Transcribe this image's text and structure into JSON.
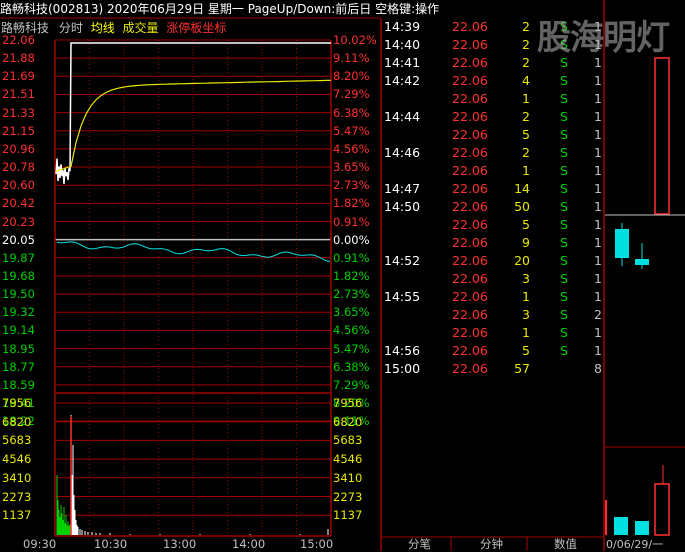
{
  "header": {
    "stock": "路畅科技(002813)",
    "date": "2020年06月29日 星期一",
    "hint": "PageUp/Down:前后日 空格键:操作",
    "sub_name": "路畅科技",
    "tab_timeshare": "分时",
    "tab_avg": "均线",
    "tab_volume": "成交量",
    "tab_limit": "涨停板坐标"
  },
  "price_axis": {
    "ref_price": 20.05,
    "up_prices": [
      "22.06",
      "21.88",
      "21.69",
      "21.51",
      "21.33",
      "21.15",
      "20.96",
      "20.78",
      "20.60",
      "20.42",
      "20.23"
    ],
    "up_pcts": [
      "10.02%",
      "9.11%",
      "8.20%",
      "7.29%",
      "6.38%",
      "5.47%",
      "4.56%",
      "3.65%",
      "2.73%",
      "1.82%",
      "0.91%"
    ],
    "ref_label": "20.05",
    "ref_pct": "0.00%",
    "down_prices": [
      "19.87",
      "19.68",
      "19.50",
      "19.32",
      "19.14",
      "18.95",
      "18.77",
      "18.59",
      "18.41",
      "18.22"
    ],
    "down_pcts": [
      "0.91%",
      "1.82%",
      "2.73%",
      "3.65%",
      "4.56%",
      "5.47%",
      "6.38%",
      "7.29%",
      "8.20%",
      "9.11%"
    ]
  },
  "volume_axis": [
    "7956",
    "6820",
    "5683",
    "4546",
    "3410",
    "2273",
    "1137"
  ],
  "time_axis": [
    "09:30",
    "10:30",
    "13:00",
    "14:00",
    "15:00"
  ],
  "ticks": [
    {
      "time": "14:39",
      "price": "22.06",
      "vol": "2",
      "bs": "S",
      "cnt": "1"
    },
    {
      "time": "14:40",
      "price": "22.06",
      "vol": "2",
      "bs": "S",
      "cnt": "1"
    },
    {
      "time": "14:41",
      "price": "22.06",
      "vol": "2",
      "bs": "S",
      "cnt": "1"
    },
    {
      "time": "14:42",
      "price": "22.06",
      "vol": "4",
      "bs": "S",
      "cnt": "1"
    },
    {
      "time": "",
      "price": "22.06",
      "vol": "1",
      "bs": "S",
      "cnt": "1"
    },
    {
      "time": "14:44",
      "price": "22.06",
      "vol": "2",
      "bs": "S",
      "cnt": "1"
    },
    {
      "time": "",
      "price": "22.06",
      "vol": "5",
      "bs": "S",
      "cnt": "1"
    },
    {
      "time": "14:46",
      "price": "22.06",
      "vol": "2",
      "bs": "S",
      "cnt": "1"
    },
    {
      "time": "",
      "price": "22.06",
      "vol": "1",
      "bs": "S",
      "cnt": "1"
    },
    {
      "time": "14:47",
      "price": "22.06",
      "vol": "14",
      "bs": "S",
      "cnt": "1"
    },
    {
      "time": "14:50",
      "price": "22.06",
      "vol": "50",
      "bs": "S",
      "cnt": "1"
    },
    {
      "time": "",
      "price": "22.06",
      "vol": "5",
      "bs": "S",
      "cnt": "1"
    },
    {
      "time": "",
      "price": "22.06",
      "vol": "9",
      "bs": "S",
      "cnt": "1"
    },
    {
      "time": "14:52",
      "price": "22.06",
      "vol": "20",
      "bs": "S",
      "cnt": "1"
    },
    {
      "time": "",
      "price": "22.06",
      "vol": "3",
      "bs": "S",
      "cnt": "1"
    },
    {
      "time": "14:55",
      "price": "22.06",
      "vol": "1",
      "bs": "S",
      "cnt": "1"
    },
    {
      "time": "",
      "price": "22.06",
      "vol": "3",
      "bs": "S",
      "cnt": "2"
    },
    {
      "time": "",
      "price": "22.06",
      "vol": "1",
      "bs": "S",
      "cnt": "1"
    },
    {
      "time": "14:56",
      "price": "22.06",
      "vol": "5",
      "bs": "S",
      "cnt": "1"
    },
    {
      "time": "15:00",
      "price": "22.06",
      "vol": "57",
      "bs": "",
      "cnt": "8"
    }
  ],
  "bottom_tabs": [
    "分笔",
    "分钟",
    "数值"
  ],
  "side_date": "0/06/29/一",
  "watermark": "股海明灯",
  "colors": {
    "red": "#ff3030",
    "green": "#00d000",
    "yellow": "#e8e800",
    "cyan": "#00e0e0",
    "white": "#ffffff",
    "grid": "#a00000"
  }
}
